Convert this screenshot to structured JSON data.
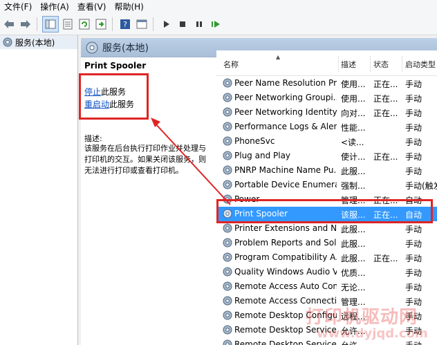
{
  "menu": [
    "文件(F)",
    "操作(A)",
    "查看(V)",
    "帮助(H)"
  ],
  "toolbar_icons": [
    "back-arrow-icon",
    "forward-arrow-icon",
    "show-tree-icon",
    "properties-icon",
    "refresh-icon",
    "export-icon",
    "help-icon",
    "console-icon",
    "start-icon",
    "stop-icon",
    "pause-icon",
    "restart-icon"
  ],
  "tree": {
    "label": "服务(本地)"
  },
  "pane": {
    "title": "服务(本地)"
  },
  "ext": {
    "service_name": "Print Spooler",
    "stop_link": "停止",
    "stop_suffix": "此服务",
    "restart_link": "重启动",
    "restart_suffix": "此服务",
    "desc_label": "描述:",
    "desc_text": "该服务在后台执行打印作业并处理与打印机的交互。如果关闭该服务，则无法进行打印或查看打印机。"
  },
  "columns": {
    "name": "名称",
    "desc": "描述",
    "status": "状态",
    "startup": "启动类型"
  },
  "rows": [
    {
      "name": "Peer Name Resolution Pr...",
      "desc": "使用...",
      "status": "正在...",
      "startup": "手动"
    },
    {
      "name": "Peer Networking Groupi...",
      "desc": "使用...",
      "status": "正在...",
      "startup": "手动"
    },
    {
      "name": "Peer Networking Identity...",
      "desc": "向对...",
      "status": "正在...",
      "startup": "手动"
    },
    {
      "name": "Performance Logs & Aler...",
      "desc": "性能...",
      "status": "",
      "startup": "手动"
    },
    {
      "name": "PhoneSvc",
      "desc": "<读...",
      "status": "",
      "startup": "手动"
    },
    {
      "name": "Plug and Play",
      "desc": "使计...",
      "status": "正在...",
      "startup": "手动"
    },
    {
      "name": "PNRP Machine Name Pu...",
      "desc": "此服...",
      "status": "",
      "startup": "手动"
    },
    {
      "name": "Portable Device Enumera...",
      "desc": "强制...",
      "status": "",
      "startup": "手动(触发"
    },
    {
      "name": "Power",
      "desc": "管理...",
      "status": "正在...",
      "startup": "自动"
    },
    {
      "name": "Print Spooler",
      "desc": "该服...",
      "status": "正在...",
      "startup": "自动",
      "selected": true
    },
    {
      "name": "Printer Extensions and N...",
      "desc": "此服...",
      "status": "",
      "startup": "手动"
    },
    {
      "name": "Problem Reports and Sol...",
      "desc": "此服...",
      "status": "",
      "startup": "手动"
    },
    {
      "name": "Program Compatibility A...",
      "desc": "此服...",
      "status": "正在...",
      "startup": "手动"
    },
    {
      "name": "Quality Windows Audio V...",
      "desc": "优质...",
      "status": "",
      "startup": "手动"
    },
    {
      "name": "Remote Access Auto Con...",
      "desc": "无论...",
      "status": "",
      "startup": "手动"
    },
    {
      "name": "Remote Access Connecti...",
      "desc": "管理...",
      "status": "",
      "startup": "手动"
    },
    {
      "name": "Remote Desktop Configu...",
      "desc": "远程...",
      "status": "",
      "startup": "手动"
    },
    {
      "name": "Remote Desktop Services",
      "desc": "允许...",
      "status": "",
      "startup": "手动"
    },
    {
      "name": "Remote Desktop Service...",
      "desc": "允许...",
      "status": "",
      "startup": "手动"
    }
  ],
  "watermark": {
    "line1": "打印机驱动网",
    "line2": "www.dyjqd.com"
  },
  "colors": {
    "annotation_red": "#e02424",
    "selection_blue": "#3399ff",
    "link_blue": "#0b4fc4"
  }
}
